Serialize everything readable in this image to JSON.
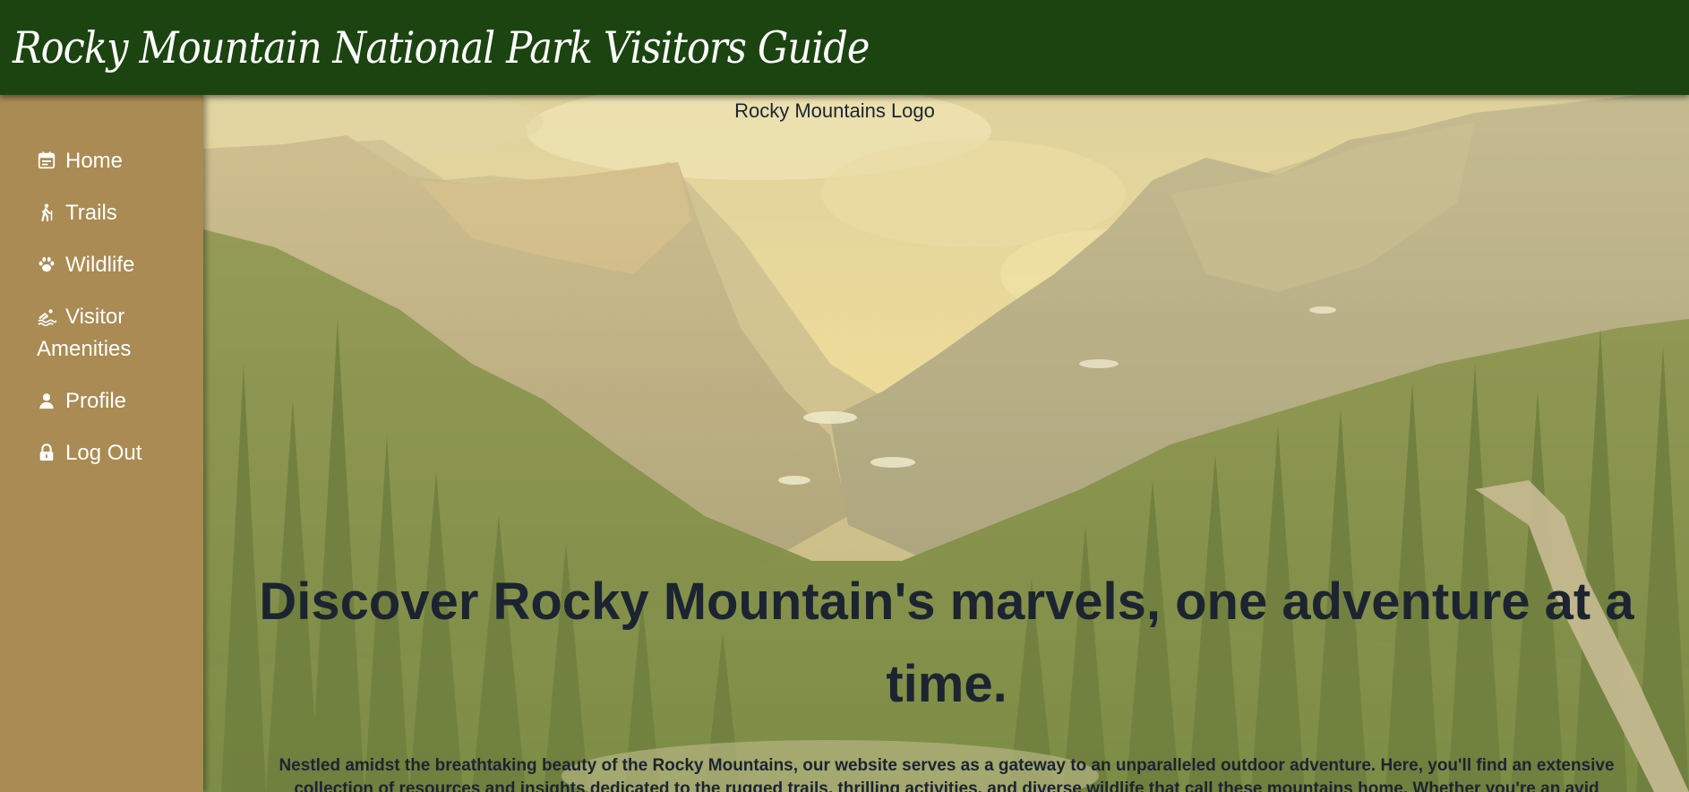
{
  "header": {
    "title": "Rocky Mountain National Park Visitors Guide"
  },
  "sidebar": {
    "items": [
      {
        "label": "Home",
        "icon": "calendar-icon"
      },
      {
        "label": "Trails",
        "icon": "hiker-icon"
      },
      {
        "label": "Wildlife",
        "icon": "paw-icon"
      },
      {
        "label": "Visitor Amenities",
        "icon": "swimmer-icon"
      },
      {
        "label": "Profile",
        "icon": "user-icon"
      },
      {
        "label": "Log Out",
        "icon": "lock-icon"
      }
    ]
  },
  "hero": {
    "logo_alt": "Rocky Mountains Logo",
    "heading": "Discover Rocky Mountain's marvels, one adventure at a time.",
    "paragraph": "Nestled amidst the breathtaking beauty of the Rocky Mountains, our website serves as a gateway to an unparalleled outdoor adventure. Here, you'll find an extensive collection of resources and insights dedicated to the rugged trails, thrilling activities, and diverse wildlife that call these mountains home. Whether you're an avid hiker"
  },
  "colors": {
    "header_bg": "#1b4410",
    "sidebar_bg": "#a98b53",
    "text_dark": "#1c2431",
    "nav_text": "#ffffff"
  }
}
